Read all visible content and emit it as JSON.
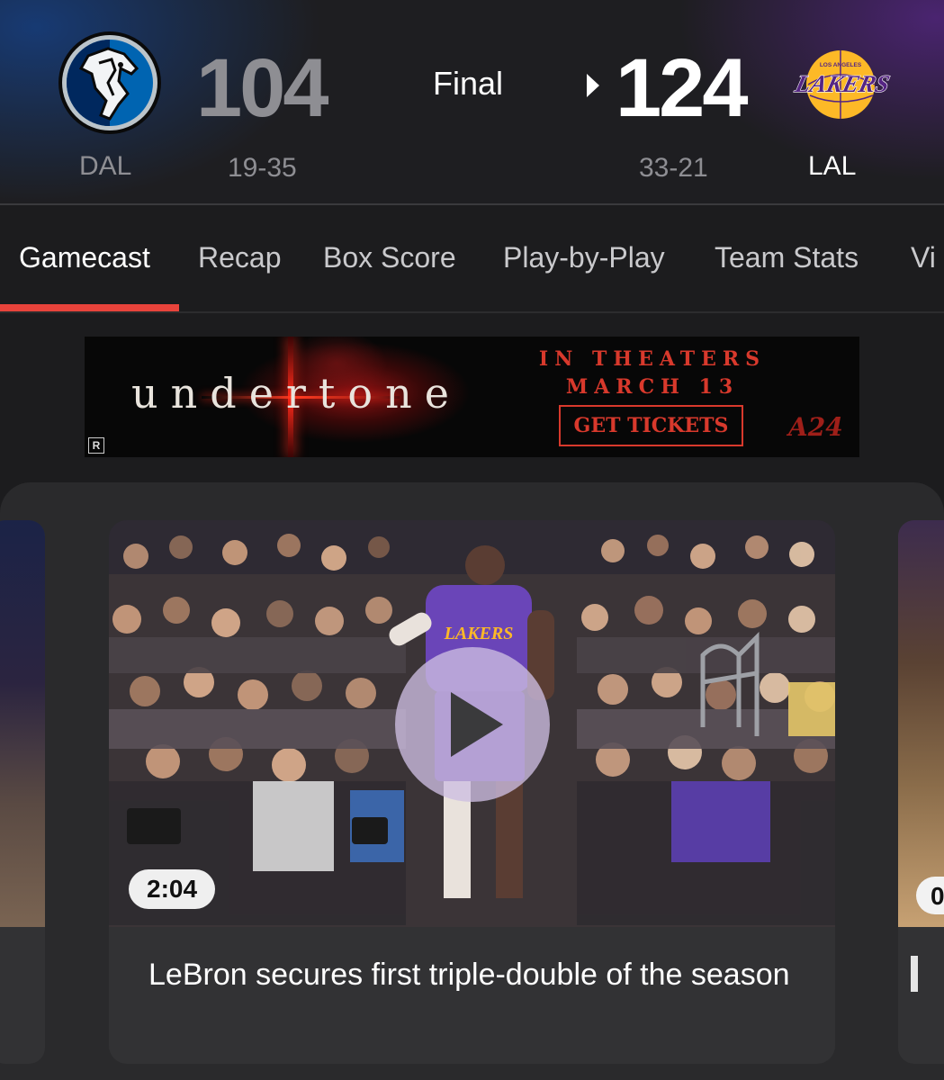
{
  "game": {
    "status": "Final",
    "away": {
      "abbr": "DAL",
      "score": "104",
      "record": "19-35",
      "logo": "mavericks-logo",
      "colors": {
        "primary": "#0064b1",
        "secondary": "#00285e",
        "silver": "#bbc4ca"
      }
    },
    "home": {
      "abbr": "LAL",
      "score": "124",
      "record": "33-21",
      "logo": "lakers-logo",
      "logo_text_small": "LOS ANGELES",
      "logo_text": "LAKERS",
      "winner": true,
      "colors": {
        "primary": "#552583",
        "secondary": "#fdb927"
      }
    }
  },
  "tabs": {
    "items": [
      {
        "label": "Gamecast",
        "active": true
      },
      {
        "label": "Recap",
        "active": false
      },
      {
        "label": "Box Score",
        "active": false
      },
      {
        "label": "Play-by-Play",
        "active": false
      },
      {
        "label": "Team Stats",
        "active": false
      },
      {
        "label": "Vi",
        "active": false
      }
    ],
    "accent": "#e8433b"
  },
  "ad": {
    "title": "undertone",
    "tagline_line1": "IN THEATERS",
    "tagline_line2": "MARCH 13",
    "cta": "GET TICKETS",
    "brand": "A24",
    "rating": "R"
  },
  "videos": {
    "featured": {
      "duration": "2:04",
      "title": "LeBron secures first triple-double of the season",
      "jersey_text": "LAKERS",
      "icon": "play-icon"
    },
    "next_preview": {
      "duration_partial": "0"
    }
  }
}
